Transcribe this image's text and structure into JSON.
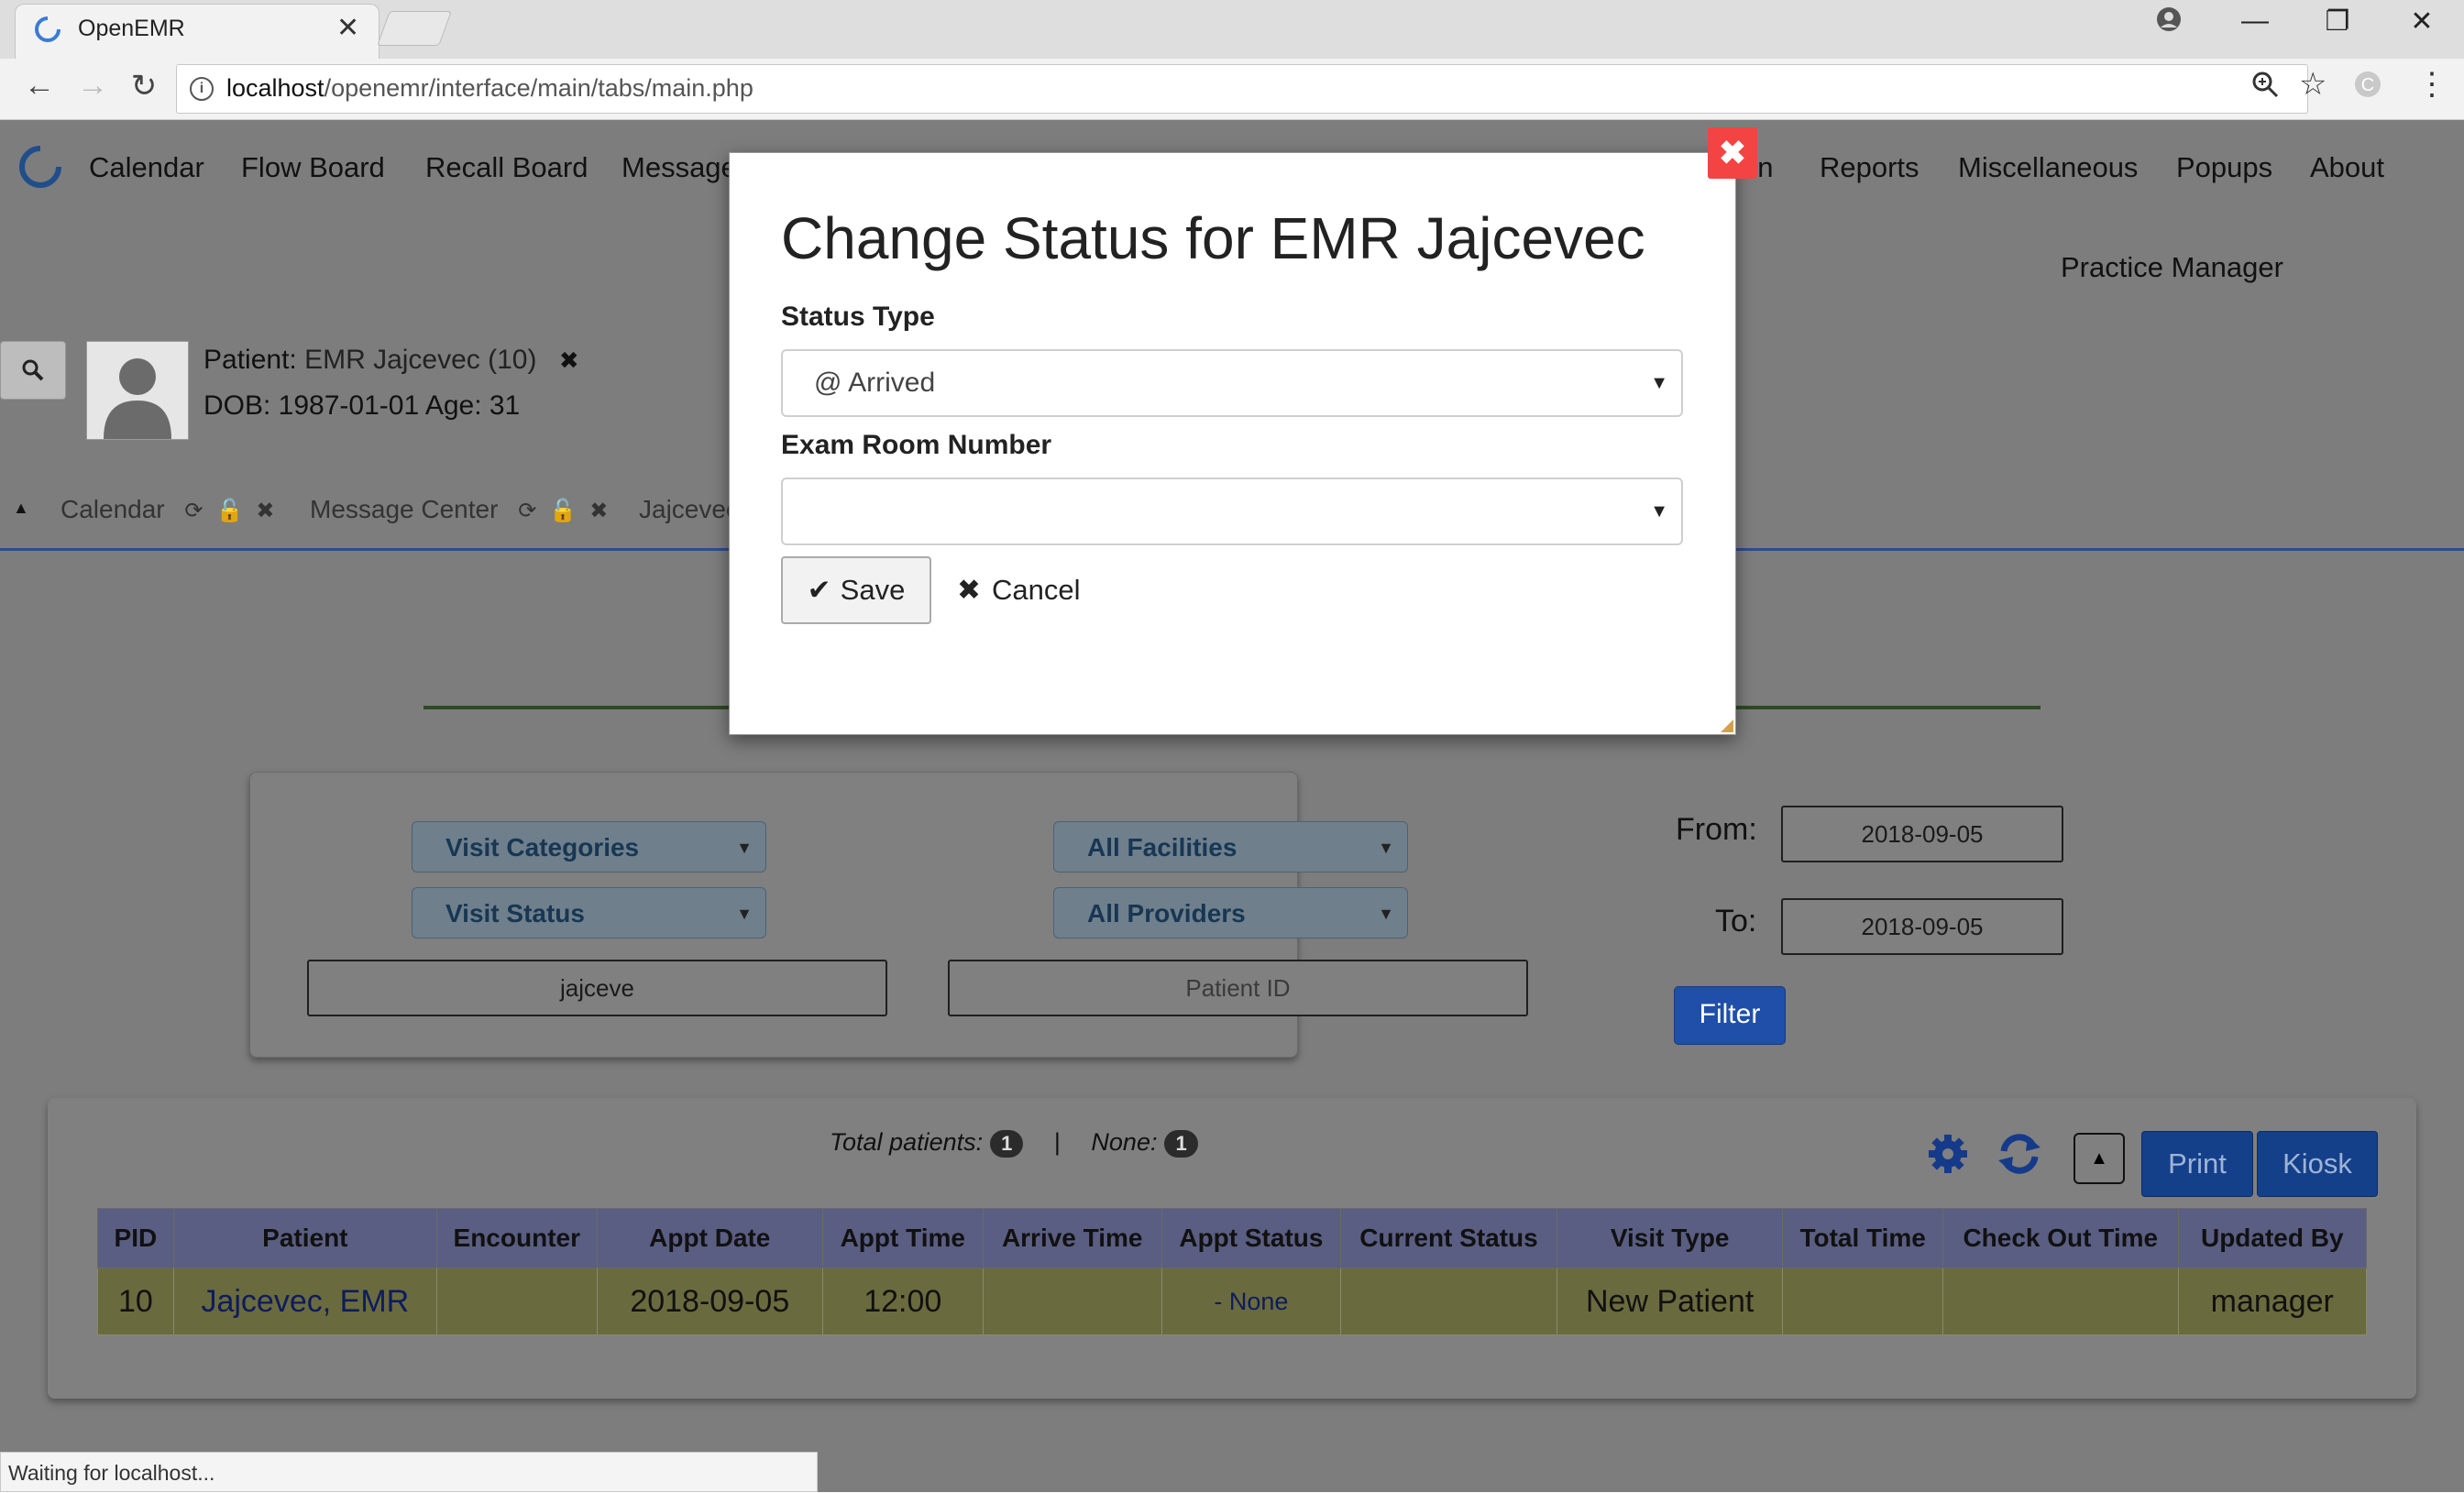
{
  "browser": {
    "tab_title": "OpenEMR",
    "tab_close": "✕",
    "url_host": "localhost",
    "url_path": "/openemr/interface/main/tabs/main.php",
    "status_text": "Waiting for localhost..."
  },
  "menu": {
    "items": [
      "Calendar",
      "Flow Board",
      "Recall Board",
      "Message",
      "on",
      "Reports",
      "Miscellaneous",
      "Popups",
      "About"
    ],
    "user": "Practice Manager"
  },
  "patient": {
    "label": "Patient:",
    "name": "EMR Jajcevec (10)",
    "dob_line": "DOB: 1987-01-01 Age: 31",
    "close": "✖"
  },
  "open_tabs": [
    "Calendar",
    "Message Center",
    "Jajcevec"
  ],
  "filters": {
    "visit_categories": "Visit Categories",
    "visit_status": "Visit Status",
    "all_facilities": "All Facilities",
    "all_providers": "All Providers",
    "search_value": "jajceve",
    "patient_id_placeholder": "Patient ID",
    "from_label": "From:",
    "from_value": "2018-09-05",
    "to_label": "To:",
    "to_value": "2018-09-05",
    "filter_button": "Filter"
  },
  "results": {
    "total_label": "Total patients:",
    "total_count": "1",
    "separator": "|",
    "none_label": "None:",
    "none_count": "1",
    "print_button": "Print",
    "kiosk_button": "Kiosk",
    "columns": [
      "PID",
      "Patient",
      "Encounter",
      "Appt Date",
      "Appt Time",
      "Arrive Time",
      "Appt Status",
      "Current Status",
      "Visit Type",
      "Total Time",
      "Check Out Time",
      "Updated By"
    ],
    "rows": [
      {
        "pid": "10",
        "patient": "Jajcevec, EMR",
        "encounter": "",
        "appt_date": "2018-09-05",
        "appt_time": "12:00",
        "arrive_time": "",
        "appt_status": "- None",
        "current_status": "",
        "visit_type": "New Patient",
        "total_time": "",
        "check_out_time": "",
        "updated_by": "manager"
      }
    ]
  },
  "modal": {
    "title": "Change Status for EMR Jajcevec",
    "status_type_label": "Status Type",
    "status_type_value": "@ Arrived",
    "exam_room_label": "Exam Room Number",
    "exam_room_value": "",
    "save_label": "Save",
    "cancel_label": "Cancel",
    "close": "✖"
  },
  "colors": {
    "modal_close": "#f44343",
    "filter_button": "#1f4fa8",
    "print_kiosk": "#14408a",
    "overlay": "#7d7d7d"
  }
}
